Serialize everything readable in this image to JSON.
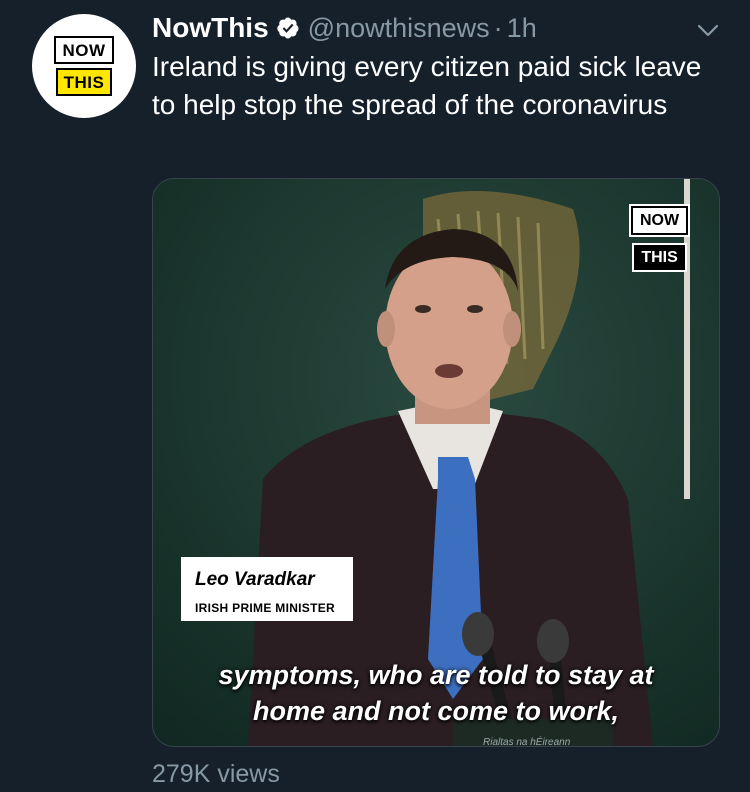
{
  "account": {
    "display_name": "NowThis",
    "handle": "@nowthisnews",
    "separator": "·",
    "time": "1h",
    "avatar_logo": {
      "top": "NOW",
      "bottom": "THIS"
    },
    "verified_color": "#ffffff"
  },
  "tweet": {
    "text": "Ireland is giving every citizen paid sick leave to help stop the spread of the coronavirus"
  },
  "media": {
    "watermark": {
      "top": "NOW",
      "bottom": "THIS"
    },
    "lower_third": {
      "name": "Leo Varadkar",
      "title": "IRISH PRIME MINISTER"
    },
    "subtitle_line1": "symptoms, who are told to stay at",
    "subtitle_line2": "home and not come to work,",
    "plaque_text": "Rialtas na hÉireann"
  },
  "stats": {
    "views": "279K views"
  },
  "icons": {
    "verified": "verified-badge-icon",
    "caret": "chevron-down-icon"
  },
  "colors": {
    "background": "#15202b",
    "secondary_text": "#8899a6",
    "logo_yellow": "#ffe600"
  }
}
